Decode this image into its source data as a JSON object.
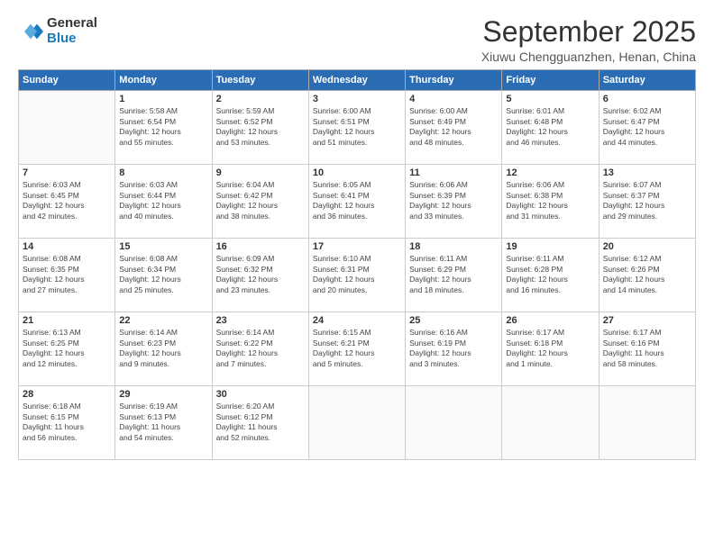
{
  "logo": {
    "general": "General",
    "blue": "Blue"
  },
  "header": {
    "title": "September 2025",
    "location": "Xiuwu Chengguanzhen, Henan, China"
  },
  "days_of_week": [
    "Sunday",
    "Monday",
    "Tuesday",
    "Wednesday",
    "Thursday",
    "Friday",
    "Saturday"
  ],
  "weeks": [
    [
      {
        "day": "",
        "info": ""
      },
      {
        "day": "1",
        "info": "Sunrise: 5:58 AM\nSunset: 6:54 PM\nDaylight: 12 hours\nand 55 minutes."
      },
      {
        "day": "2",
        "info": "Sunrise: 5:59 AM\nSunset: 6:52 PM\nDaylight: 12 hours\nand 53 minutes."
      },
      {
        "day": "3",
        "info": "Sunrise: 6:00 AM\nSunset: 6:51 PM\nDaylight: 12 hours\nand 51 minutes."
      },
      {
        "day": "4",
        "info": "Sunrise: 6:00 AM\nSunset: 6:49 PM\nDaylight: 12 hours\nand 48 minutes."
      },
      {
        "day": "5",
        "info": "Sunrise: 6:01 AM\nSunset: 6:48 PM\nDaylight: 12 hours\nand 46 minutes."
      },
      {
        "day": "6",
        "info": "Sunrise: 6:02 AM\nSunset: 6:47 PM\nDaylight: 12 hours\nand 44 minutes."
      }
    ],
    [
      {
        "day": "7",
        "info": "Sunrise: 6:03 AM\nSunset: 6:45 PM\nDaylight: 12 hours\nand 42 minutes."
      },
      {
        "day": "8",
        "info": "Sunrise: 6:03 AM\nSunset: 6:44 PM\nDaylight: 12 hours\nand 40 minutes."
      },
      {
        "day": "9",
        "info": "Sunrise: 6:04 AM\nSunset: 6:42 PM\nDaylight: 12 hours\nand 38 minutes."
      },
      {
        "day": "10",
        "info": "Sunrise: 6:05 AM\nSunset: 6:41 PM\nDaylight: 12 hours\nand 36 minutes."
      },
      {
        "day": "11",
        "info": "Sunrise: 6:06 AM\nSunset: 6:39 PM\nDaylight: 12 hours\nand 33 minutes."
      },
      {
        "day": "12",
        "info": "Sunrise: 6:06 AM\nSunset: 6:38 PM\nDaylight: 12 hours\nand 31 minutes."
      },
      {
        "day": "13",
        "info": "Sunrise: 6:07 AM\nSunset: 6:37 PM\nDaylight: 12 hours\nand 29 minutes."
      }
    ],
    [
      {
        "day": "14",
        "info": "Sunrise: 6:08 AM\nSunset: 6:35 PM\nDaylight: 12 hours\nand 27 minutes."
      },
      {
        "day": "15",
        "info": "Sunrise: 6:08 AM\nSunset: 6:34 PM\nDaylight: 12 hours\nand 25 minutes."
      },
      {
        "day": "16",
        "info": "Sunrise: 6:09 AM\nSunset: 6:32 PM\nDaylight: 12 hours\nand 23 minutes."
      },
      {
        "day": "17",
        "info": "Sunrise: 6:10 AM\nSunset: 6:31 PM\nDaylight: 12 hours\nand 20 minutes."
      },
      {
        "day": "18",
        "info": "Sunrise: 6:11 AM\nSunset: 6:29 PM\nDaylight: 12 hours\nand 18 minutes."
      },
      {
        "day": "19",
        "info": "Sunrise: 6:11 AM\nSunset: 6:28 PM\nDaylight: 12 hours\nand 16 minutes."
      },
      {
        "day": "20",
        "info": "Sunrise: 6:12 AM\nSunset: 6:26 PM\nDaylight: 12 hours\nand 14 minutes."
      }
    ],
    [
      {
        "day": "21",
        "info": "Sunrise: 6:13 AM\nSunset: 6:25 PM\nDaylight: 12 hours\nand 12 minutes."
      },
      {
        "day": "22",
        "info": "Sunrise: 6:14 AM\nSunset: 6:23 PM\nDaylight: 12 hours\nand 9 minutes."
      },
      {
        "day": "23",
        "info": "Sunrise: 6:14 AM\nSunset: 6:22 PM\nDaylight: 12 hours\nand 7 minutes."
      },
      {
        "day": "24",
        "info": "Sunrise: 6:15 AM\nSunset: 6:21 PM\nDaylight: 12 hours\nand 5 minutes."
      },
      {
        "day": "25",
        "info": "Sunrise: 6:16 AM\nSunset: 6:19 PM\nDaylight: 12 hours\nand 3 minutes."
      },
      {
        "day": "26",
        "info": "Sunrise: 6:17 AM\nSunset: 6:18 PM\nDaylight: 12 hours\nand 1 minute."
      },
      {
        "day": "27",
        "info": "Sunrise: 6:17 AM\nSunset: 6:16 PM\nDaylight: 11 hours\nand 58 minutes."
      }
    ],
    [
      {
        "day": "28",
        "info": "Sunrise: 6:18 AM\nSunset: 6:15 PM\nDaylight: 11 hours\nand 56 minutes."
      },
      {
        "day": "29",
        "info": "Sunrise: 6:19 AM\nSunset: 6:13 PM\nDaylight: 11 hours\nand 54 minutes."
      },
      {
        "day": "30",
        "info": "Sunrise: 6:20 AM\nSunset: 6:12 PM\nDaylight: 11 hours\nand 52 minutes."
      },
      {
        "day": "",
        "info": ""
      },
      {
        "day": "",
        "info": ""
      },
      {
        "day": "",
        "info": ""
      },
      {
        "day": "",
        "info": ""
      }
    ]
  ]
}
